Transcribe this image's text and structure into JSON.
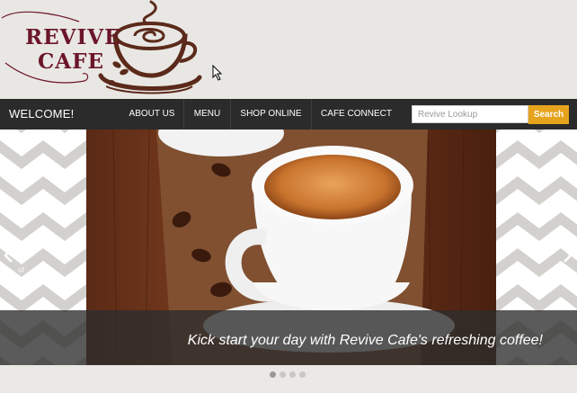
{
  "logo": {
    "line1": "REVIVE",
    "line2": "CAFE",
    "brand_color": "#6b1528",
    "icon": "coffee-cup-logo-icon"
  },
  "nav": {
    "welcome": "WELCOME!",
    "items": [
      {
        "label": "ABOUT US"
      },
      {
        "label": "MENU"
      },
      {
        "label": "SHOP ONLINE"
      },
      {
        "label": "CAFE CONNECT"
      }
    ],
    "bar_color": "#2b2b2b"
  },
  "search": {
    "placeholder": "Revive Lookup",
    "value": "",
    "button_label": "Search",
    "button_color": "#e6a31c"
  },
  "slider": {
    "counter": "of",
    "caption": "Kick start your day with Revive Cafe's refreshing coffee!",
    "prev_icon": "chevron-left-icon",
    "next_icon": "chevron-right-icon",
    "dots": [
      {
        "active": true
      },
      {
        "active": false
      },
      {
        "active": false
      },
      {
        "active": false
      }
    ]
  }
}
